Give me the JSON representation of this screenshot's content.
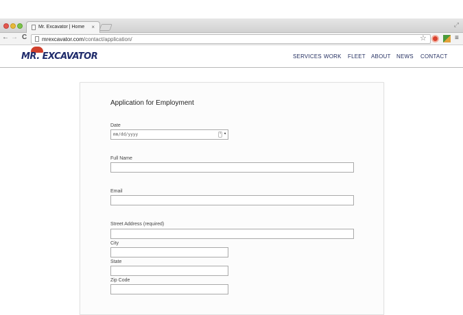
{
  "browser": {
    "tab_title": "Mr. Excavator | Home",
    "tab_close": "×",
    "url_host": "mrexcavator.com",
    "url_path": "/contact/application/",
    "back_icon": "←",
    "forward_icon": "→",
    "reload_icon": "C",
    "star_icon": "☆",
    "menu_icon": "≡",
    "expand_icon": "⤢"
  },
  "site": {
    "logo_text": "MR. EXCAVATOR",
    "nav": [
      "SERVICES",
      "WORK",
      "FLEET",
      "ABOUT",
      "NEWS",
      "CONTACT"
    ]
  },
  "form": {
    "title": "Application for Employment",
    "date_label": "Date",
    "date_placeholder": "mm/dd/yyyy",
    "date_spin": "⬍",
    "date_caret": "▾",
    "full_name_label": "Full Name",
    "email_label": "Email",
    "street_label": "Street Address (required)",
    "city_label": "City",
    "state_label": "State",
    "zip_label": "Zip Code"
  },
  "colors": {
    "nav_text": "#253062",
    "logo_blue": "#1f2b6b",
    "logo_red": "#d0402c"
  }
}
